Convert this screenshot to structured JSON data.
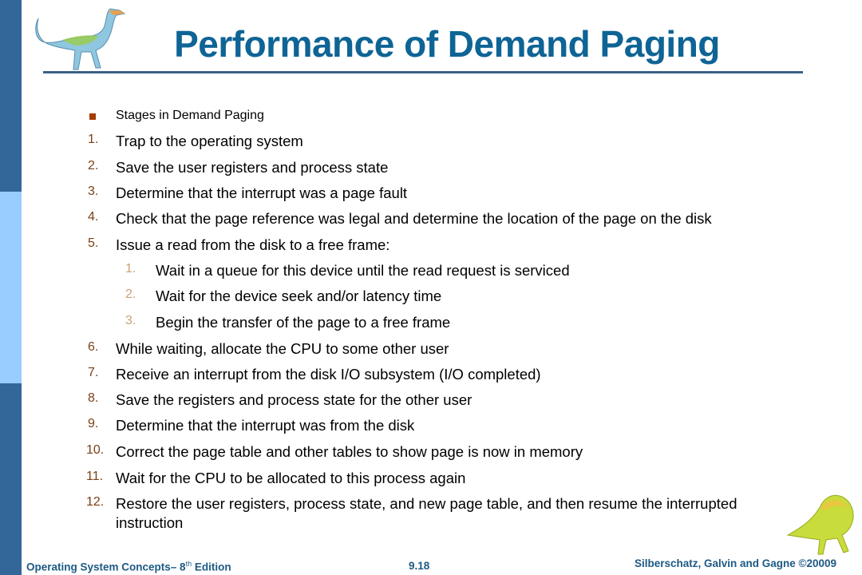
{
  "slide": {
    "title": "Performance of Demand Paging",
    "intro_bullet": "Stages in Demand Paging",
    "steps": [
      {
        "num": "1.",
        "text": "Trap to the operating system"
      },
      {
        "num": "2.",
        "text": "Save the user registers and process state"
      },
      {
        "num": "3.",
        "text": "Determine that the interrupt was a page fault"
      },
      {
        "num": "4.",
        "text": "Check that the page reference was legal and determine the location of the page on the disk"
      },
      {
        "num": "5.",
        "text": "Issue a read from the disk to a free frame:"
      }
    ],
    "substeps": [
      {
        "num": "1.",
        "text": "Wait in a queue for this device until the read request is serviced"
      },
      {
        "num": "2.",
        "text": "Wait for the device seek and/or latency time"
      },
      {
        "num": "3.",
        "text": "Begin the transfer of the page to a free frame"
      }
    ],
    "steps_after": [
      {
        "num": "6.",
        "text": "While waiting, allocate the CPU to some other user"
      },
      {
        "num": "7.",
        "text": "Receive an interrupt from the disk I/O subsystem (I/O completed)"
      },
      {
        "num": "8.",
        "text": "Save the registers and process state for the other user"
      },
      {
        "num": "9.",
        "text": "Determine that the interrupt was from the disk"
      },
      {
        "num": "10.",
        "text": "Correct the page table and other tables to show page is now in memory"
      },
      {
        "num": "11.",
        "text": "Wait for the CPU to be allocated to this process again"
      },
      {
        "num": "12.",
        "text": "Restore the user registers, process state, and new page table, and then resume the interrupted",
        "text2": "instruction"
      }
    ]
  },
  "footer": {
    "book": "Operating System Concepts– 8",
    "book_sup": "th",
    "book_tail": " Edition",
    "page": "9.18",
    "copyright": "Silberschatz, Galvin and Gagne ©20009"
  },
  "colors": {
    "title": "#0e6495",
    "strip_dark": "#336699",
    "strip_light": "#99ccff",
    "number": "#7b3f14",
    "footer": "#1d5a84"
  }
}
